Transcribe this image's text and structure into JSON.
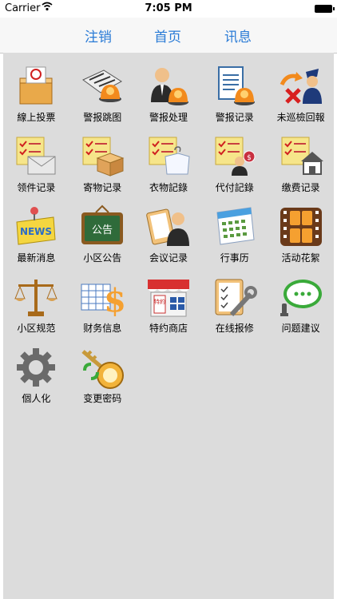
{
  "status": {
    "carrier": "Carrier",
    "time": "7:05 PM"
  },
  "nav": {
    "logout": "注销",
    "home": "首页",
    "message": "讯息"
  },
  "tiles": [
    {
      "label": "線上投票",
      "icon": "ballot-box-icon"
    },
    {
      "label": "警报跳图",
      "icon": "alarm-map-icon"
    },
    {
      "label": "警报处理",
      "icon": "alarm-handler-icon"
    },
    {
      "label": "警报记录",
      "icon": "alarm-log-icon"
    },
    {
      "label": "未巡檢回報",
      "icon": "patrol-report-icon"
    },
    {
      "label": "领件记录",
      "icon": "mail-pickup-icon"
    },
    {
      "label": "寄物记录",
      "icon": "package-deposit-icon"
    },
    {
      "label": "衣物記錄",
      "icon": "clothes-log-icon"
    },
    {
      "label": "代付記錄",
      "icon": "proxy-pay-icon"
    },
    {
      "label": "缴费记录",
      "icon": "fee-payment-icon"
    },
    {
      "label": "最新消息",
      "icon": "news-icon"
    },
    {
      "label": "小区公告",
      "icon": "announcement-board-icon"
    },
    {
      "label": "会议记录",
      "icon": "meeting-notes-icon"
    },
    {
      "label": "行事历",
      "icon": "calendar-icon"
    },
    {
      "label": "活动花絮",
      "icon": "film-strip-icon"
    },
    {
      "label": "小区规范",
      "icon": "scales-icon"
    },
    {
      "label": "财务信息",
      "icon": "finance-icon"
    },
    {
      "label": "特约商店",
      "icon": "store-icon"
    },
    {
      "label": "在线报修",
      "icon": "repair-tools-icon"
    },
    {
      "label": "问题建议",
      "icon": "chat-bubble-icon"
    },
    {
      "label": "個人化",
      "icon": "gear-icon"
    },
    {
      "label": "变更密码",
      "icon": "key-icon"
    }
  ],
  "tile_badges": {
    "news": "NEWS",
    "announcement": "公告",
    "store_sign": "特約"
  }
}
